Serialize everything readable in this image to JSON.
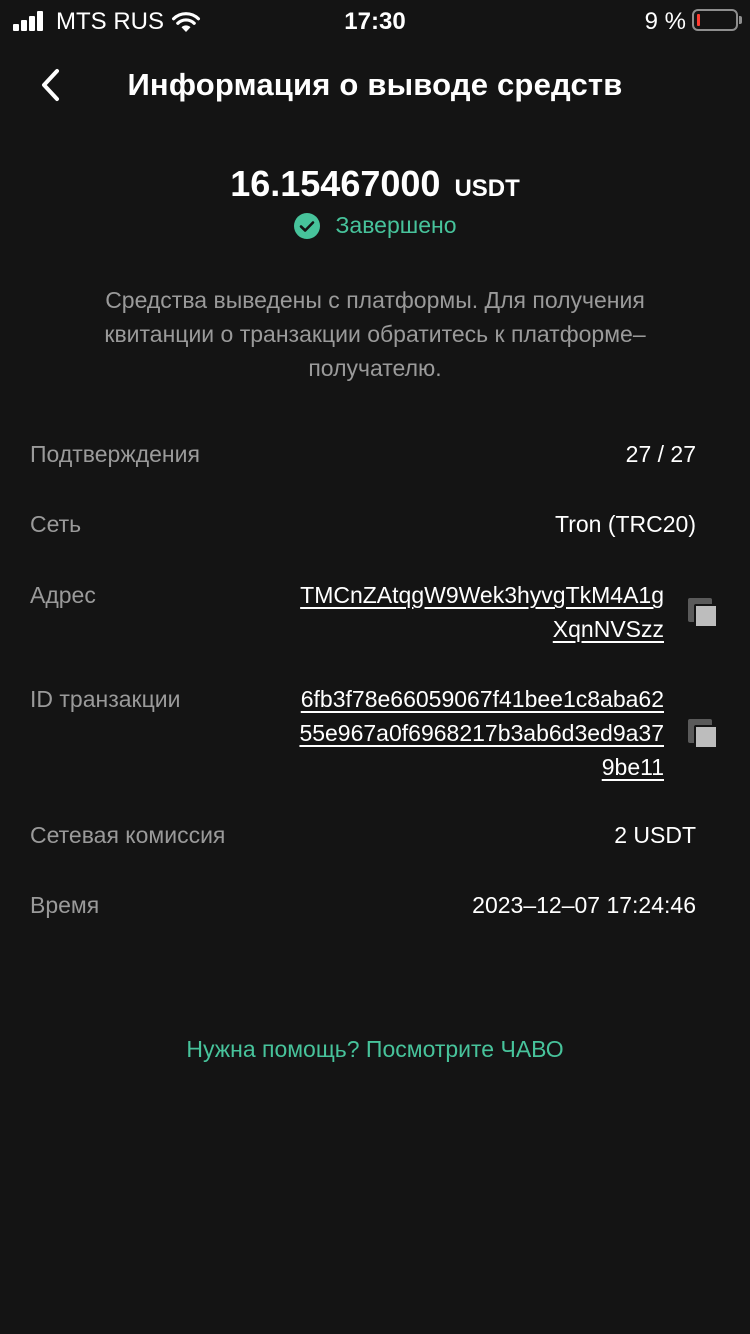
{
  "status_bar": {
    "carrier": "MTS RUS",
    "time": "17:30",
    "battery_percent": "9 %",
    "battery_level": 0.09
  },
  "header": {
    "title": "Информация о выводе средств"
  },
  "summary": {
    "amount": "16.15467000",
    "currency": "USDT",
    "status": "Завершено",
    "note": "Средства выведены с платформы. Для получения квитанции о транзакции обратитесь к платформе–получателю."
  },
  "details": {
    "confirmations": {
      "label": "Подтверждения",
      "value": "27 / 27"
    },
    "network": {
      "label": "Сеть",
      "value": "Tron (TRC20)"
    },
    "address": {
      "label": "Адрес",
      "lines": [
        "TMCnZAtqgW9Wek3hyvgTkM4A1g",
        "XqnNVSzz"
      ]
    },
    "txid": {
      "label": "ID транзакции",
      "lines": [
        "6fb3f78e66059067f41bee1c8aba62",
        "55e967a0f6968217b3ab6d3ed9a37",
        "9be11"
      ]
    },
    "fee": {
      "label": "Сетевая комиссия",
      "value": "2 USDT"
    },
    "time": {
      "label": "Время",
      "value": "2023–12–07 17:24:46"
    }
  },
  "help_link": "Нужна помощь? Посмотрите ЧАВО",
  "colors": {
    "background": "#141414",
    "accent": "#47c39b",
    "muted_text": "#9a9a9a",
    "battery_low": "#ff3b30"
  },
  "icons": {
    "back": "chevron-left-icon",
    "status": "check-circle-icon",
    "copy": "copy-icon"
  }
}
